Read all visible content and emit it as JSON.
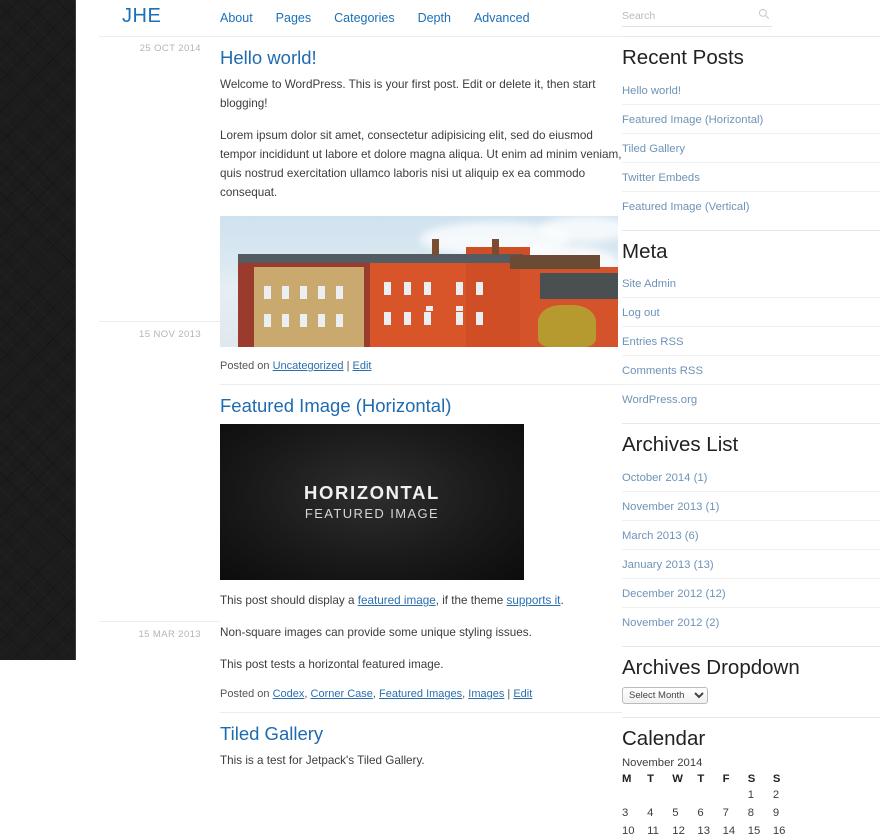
{
  "site": {
    "title": "JHE"
  },
  "nav": {
    "items": [
      {
        "label": "About"
      },
      {
        "label": "Pages"
      },
      {
        "label": "Categories"
      },
      {
        "label": "Depth"
      },
      {
        "label": "Advanced"
      }
    ]
  },
  "search": {
    "placeholder": "Search",
    "value": "",
    "icon": "search-icon"
  },
  "dates": [
    {
      "label": "25 OCT 2014"
    },
    {
      "label": "15 NOV 2013"
    },
    {
      "label": "15 MAR 2013"
    }
  ],
  "posts": [
    {
      "title": "Hello world!",
      "paragraphs": [
        "Welcome to WordPress. This is your first post. Edit or delete it, then start blogging!",
        "Lorem ipsum dolor sit amet, consectetur adipisicing elit, sed do eiusmod tempor incididunt ut labore et dolore magna aliqua. Ut enim ad minim veniam, quis nostrud exercitation ullamco laboris nisi ut aliquip ex ea commodo consequat."
      ],
      "meta_prefix": "Posted on ",
      "meta_links": [
        "Uncategorized"
      ],
      "meta_separator": " | ",
      "meta_edit": "Edit"
    },
    {
      "title": "Featured Image (Horizontal)",
      "banner_top": "HORIZONTAL",
      "banner_bottom": "FEATURED IMAGE",
      "p1_a": "This post should display a ",
      "p1_link1": "featured image",
      "p1_b": ", if the theme ",
      "p1_link2": "supports it",
      "p1_c": ".",
      "p2": "Non-square images can provide some unique styling issues.",
      "p3": "This post tests a horizontal featured image.",
      "meta_prefix": "Posted on ",
      "meta_links": [
        "Codex",
        "Corner Case",
        "Featured Images",
        "Images"
      ],
      "meta_separator": " | ",
      "meta_edit": "Edit"
    },
    {
      "title": "Tiled Gallery",
      "paragraphs": [
        "This is a test for Jetpack's Tiled Gallery."
      ]
    }
  ],
  "sidebar": {
    "recent_posts": {
      "title": "Recent Posts",
      "items": [
        {
          "label": "Hello world!"
        },
        {
          "label": "Featured Image (Horizontal)"
        },
        {
          "label": "Tiled Gallery"
        },
        {
          "label": "Twitter Embeds"
        },
        {
          "label": "Featured Image (Vertical)"
        }
      ]
    },
    "meta": {
      "title": "Meta",
      "items": [
        {
          "label": "Site Admin"
        },
        {
          "label": "Log out"
        },
        {
          "label": "Entries RSS"
        },
        {
          "label": "Comments RSS"
        },
        {
          "label": "WordPress.org"
        }
      ]
    },
    "archives_list": {
      "title": "Archives List",
      "items": [
        {
          "label": "October 2014 (1)"
        },
        {
          "label": "November 2013 (1)"
        },
        {
          "label": "March 2013 (6)"
        },
        {
          "label": "January 2013 (13)"
        },
        {
          "label": "December 2012 (12)"
        },
        {
          "label": "November 2012 (2)"
        }
      ]
    },
    "archives_dropdown": {
      "title": "Archives Dropdown",
      "selected": "Select Month"
    },
    "calendar": {
      "title": "Calendar",
      "caption": "November 2014",
      "weekdays": [
        "M",
        "T",
        "W",
        "T",
        "F",
        "S",
        "S"
      ],
      "weeks": [
        [
          "",
          "",
          "",
          "",
          "",
          "1",
          "2"
        ],
        [
          "3",
          "4",
          "5",
          "6",
          "7",
          "8",
          "9"
        ],
        [
          "10",
          "11",
          "12",
          "13",
          "14",
          "15",
          "16"
        ]
      ]
    }
  },
  "colors": {
    "link_blue": "#1f6bb0",
    "sidebar_link": "#6e93b8",
    "rail_dark": "#1c1c1c",
    "text": "#3d3d3d"
  }
}
